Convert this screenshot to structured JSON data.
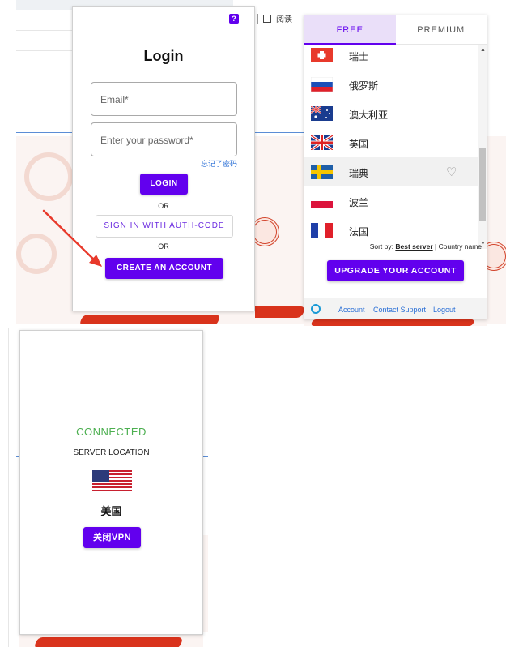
{
  "toolbar": {
    "reader_label": "阅读"
  },
  "login": {
    "title": "Login",
    "help_icon": "?",
    "email_placeholder": "Email*",
    "password_placeholder": "Enter your password*",
    "forgot_link": "忘记了密码",
    "login_button": "LOGIN",
    "or_1": "OR",
    "auth_code_button": "SIGN IN WITH AUTH-CODE",
    "or_2": "OR",
    "create_account_button": "CREATE AN ACCOUNT"
  },
  "servers": {
    "tabs": [
      {
        "label": "FREE",
        "active": true
      },
      {
        "label": "PREMIUM",
        "active": false
      }
    ],
    "items": [
      {
        "name": "瑞士",
        "flag": "switzerland"
      },
      {
        "name": "俄罗斯",
        "flag": "russia"
      },
      {
        "name": "澳大利亚",
        "flag": "australia"
      },
      {
        "name": "英国",
        "flag": "uk"
      },
      {
        "name": "瑞典",
        "flag": "sweden",
        "highlighted": true
      },
      {
        "name": "波兰",
        "flag": "poland"
      },
      {
        "name": "法国",
        "flag": "france"
      }
    ],
    "sort_prefix": "Sort by:",
    "sort_best": "Best server",
    "sort_sep": " | ",
    "sort_country": "Country name",
    "upgrade_button": "UPGRADE YOUR ACCOUNT",
    "footer": {
      "account": "Account",
      "support": "Contact Support",
      "logout": "Logout"
    }
  },
  "connected": {
    "status": "CONNECTED",
    "server_location_label": "SERVER LOCATION",
    "country": "美国",
    "disconnect_button": "关闭VPN"
  },
  "colors": {
    "accent": "#6200ee",
    "connected": "#4caf50",
    "link": "#2a6fd6"
  }
}
